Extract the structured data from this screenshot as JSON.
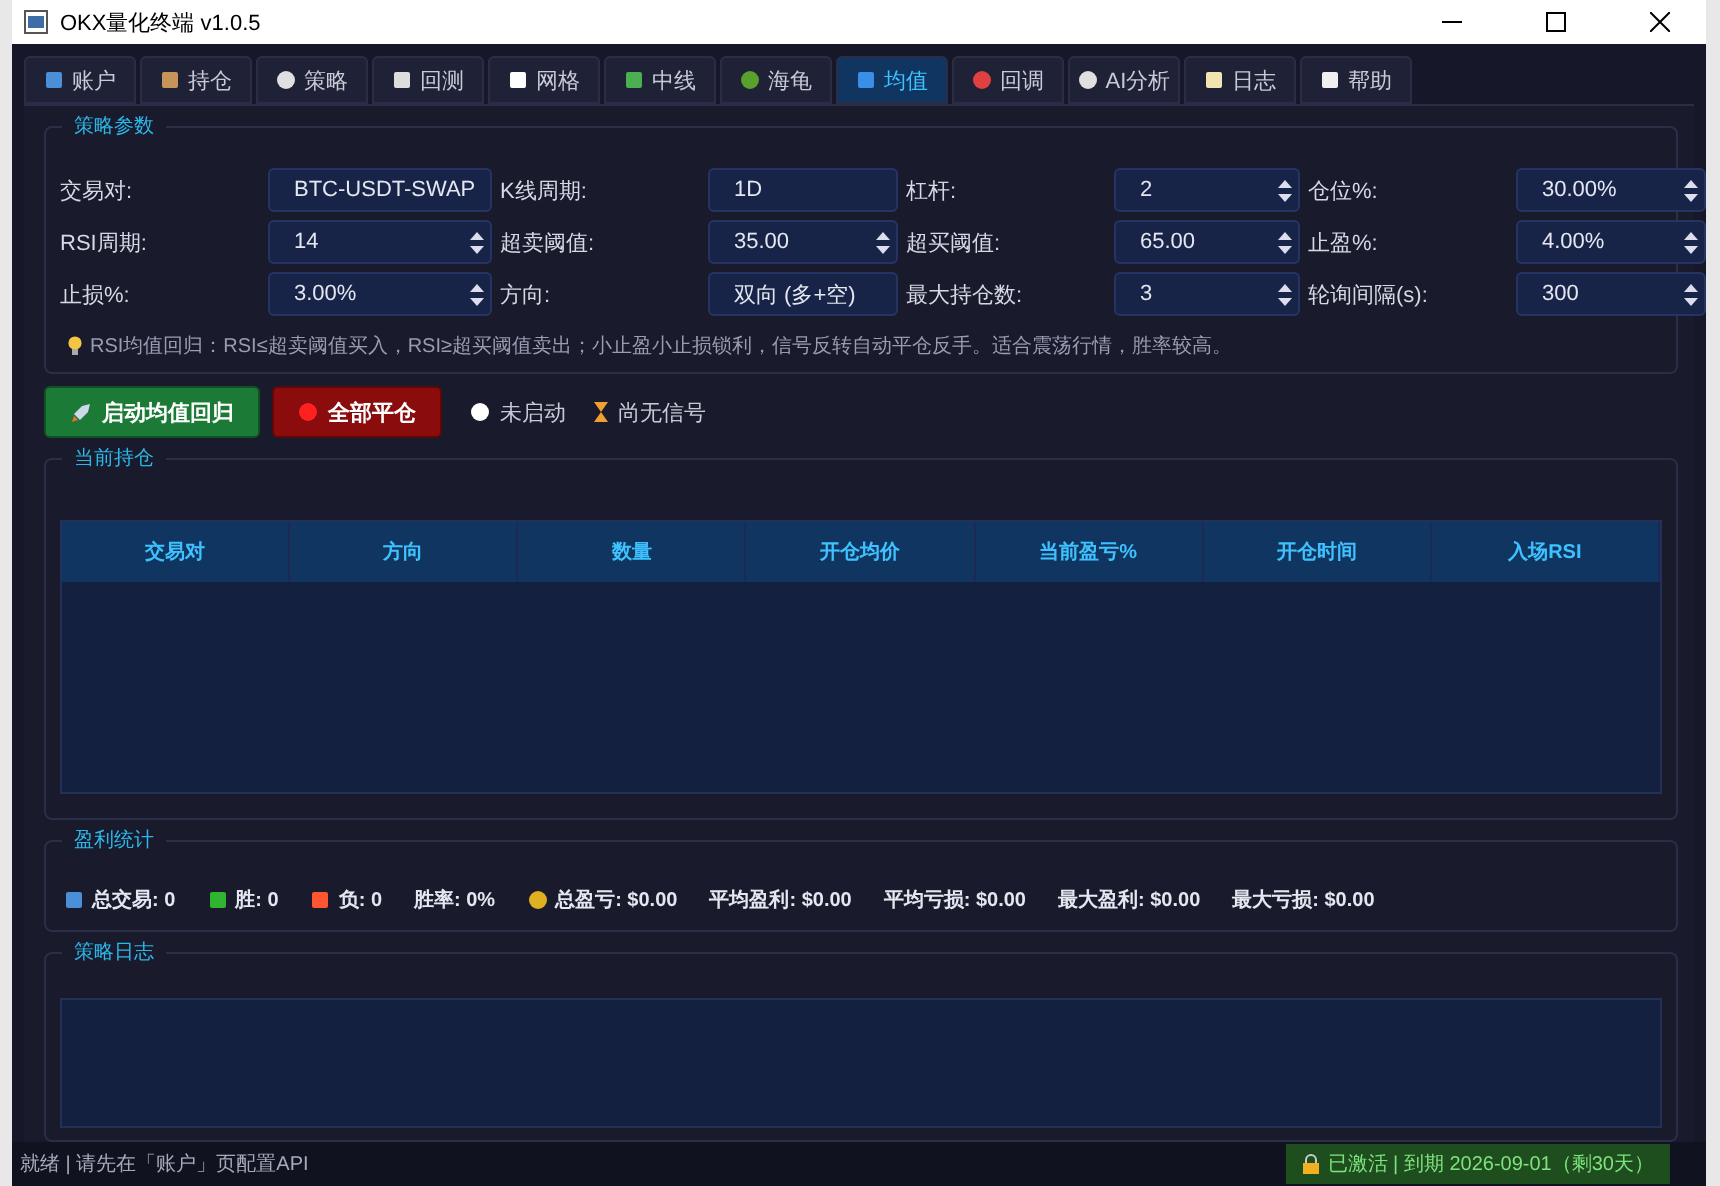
{
  "window": {
    "title": "OKX量化终端 v1.0.5"
  },
  "tabs": [
    {
      "label": "账户",
      "selected": false
    },
    {
      "label": "持仓",
      "selected": false
    },
    {
      "label": "策略",
      "selected": false
    },
    {
      "label": "回测",
      "selected": false
    },
    {
      "label": "网格",
      "selected": false
    },
    {
      "label": "中线",
      "selected": false
    },
    {
      "label": "海龟",
      "selected": false
    },
    {
      "label": "均值",
      "selected": true
    },
    {
      "label": "回调",
      "selected": false
    },
    {
      "label": "AI分析",
      "selected": false
    },
    {
      "label": "日志",
      "selected": false
    },
    {
      "label": "帮助",
      "selected": false
    }
  ],
  "params": {
    "title": "策略参数",
    "fields": [
      {
        "label": "交易对:",
        "value": "BTC-USDT-SWAP",
        "kind": "text"
      },
      {
        "label": "K线周期:",
        "value": "1D",
        "kind": "text"
      },
      {
        "label": "杠杆:",
        "value": "2",
        "kind": "spin"
      },
      {
        "label": "仓位%:",
        "value": "30.00%",
        "kind": "spin"
      },
      {
        "label": "RSI周期:",
        "value": "14",
        "kind": "spin"
      },
      {
        "label": "超卖阈值:",
        "value": "35.00",
        "kind": "spin"
      },
      {
        "label": "超买阈值:",
        "value": "65.00",
        "kind": "spin"
      },
      {
        "label": "止盈%:",
        "value": "4.00%",
        "kind": "spin"
      },
      {
        "label": "止损%:",
        "value": "3.00%",
        "kind": "spin"
      },
      {
        "label": "方向:",
        "value": "双向 (多+空)",
        "kind": "text"
      },
      {
        "label": "最大持仓数:",
        "value": "3",
        "kind": "spin"
      },
      {
        "label": "轮询间隔(s):",
        "value": "300",
        "kind": "spin"
      }
    ],
    "hint": "RSI均值回归：RSI≤超卖阈值买入，RSI≥超买阈值卖出；小止盈小止损锁利，信号反转自动平仓反手。适合震荡行情，胜率较高。"
  },
  "actions": {
    "start_button": "启动均值回归",
    "close_all_button": "全部平仓",
    "status": "未启动",
    "signal": "尚无信号"
  },
  "positions": {
    "title": "当前持仓",
    "columns": [
      "交易对",
      "方向",
      "数量",
      "开仓均价",
      "当前盈亏%",
      "开仓时间",
      "入场RSI"
    ]
  },
  "stats": {
    "title": "盈利统计",
    "items": [
      "总交易: 0",
      "胜: 0",
      "负: 0",
      "胜率: 0%",
      "总盈亏: $0.00",
      "平均盈利: $0.00",
      "平均亏损: $0.00",
      "最大盈利: $0.00",
      "最大亏损: $0.00"
    ]
  },
  "log": {
    "title": "策略日志"
  },
  "status_bar": {
    "message": "就绪 | 请先在「账户」页配置API",
    "license": "已激活 | 到期 2026-09-01（剩30天）"
  }
}
